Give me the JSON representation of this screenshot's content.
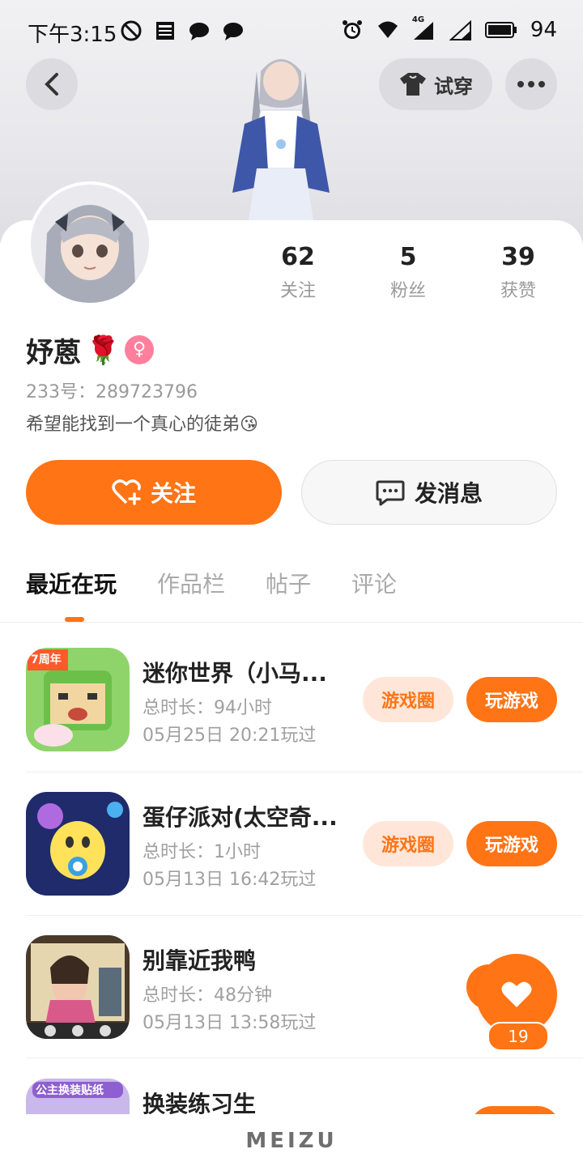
{
  "status_bar": {
    "time": "下午3:15",
    "battery": "94",
    "network": "4G"
  },
  "header": {
    "try_on_label": "试穿"
  },
  "profile": {
    "name": "妤蒽",
    "name_emoji": "🌹",
    "gender_symbol": "♀",
    "uid_line": "233号：289723796",
    "bio": "希望能找到一个真心的徒弟😘",
    "stats": [
      {
        "num": "62",
        "label": "关注"
      },
      {
        "num": "5",
        "label": "粉丝"
      },
      {
        "num": "39",
        "label": "获赞"
      }
    ],
    "follow_label": "关注",
    "message_label": "发消息"
  },
  "tabs": [
    {
      "label": "最近在玩",
      "active": true
    },
    {
      "label": "作品栏",
      "active": false
    },
    {
      "label": "帖子",
      "active": false
    },
    {
      "label": "评论",
      "active": false
    }
  ],
  "games": [
    {
      "title": "迷你世界（小马...",
      "duration": "总时长：94小时",
      "last_played": "05月25日  20:21玩过",
      "circle_label": "游戏圈",
      "play_label": "玩游戏",
      "icon_badge": "7周年"
    },
    {
      "title": "蛋仔派对(太空奇...",
      "duration": "总时长：1小时",
      "last_played": "05月13日  16:42玩过",
      "circle_label": "游戏圈",
      "play_label": "玩游戏"
    },
    {
      "title": "别靠近我鸭",
      "duration": "总时长：48分钟",
      "last_played": "05月13日  13:58玩过"
    },
    {
      "title": "换装练习生",
      "icon_badge": "公主换装贴纸"
    }
  ],
  "like_count": "19",
  "brand": "MEIZU",
  "colors": {
    "accent": "#ff7415",
    "accent_light": "#ffe6d8",
    "gender": "#ff7f9c"
  }
}
